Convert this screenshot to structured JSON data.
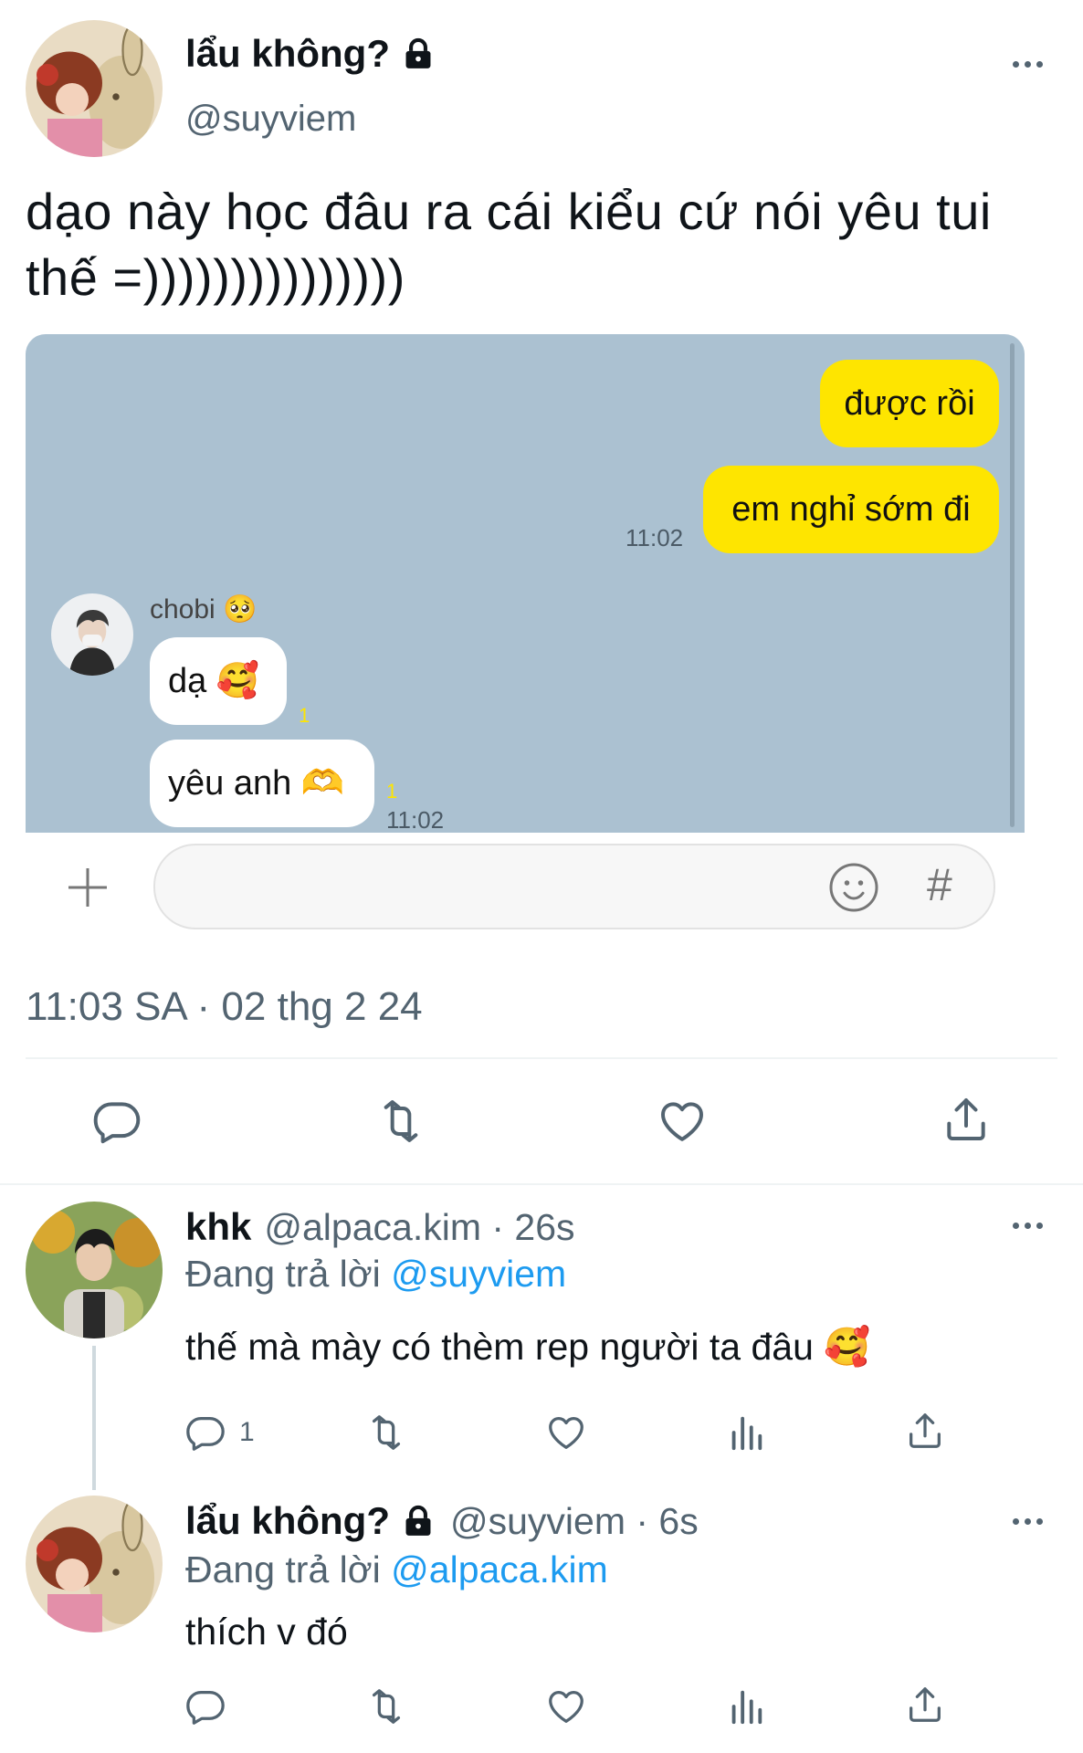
{
  "main_tweet": {
    "display_name": "lẩu không?",
    "handle": "@suyviem",
    "text_line1": "dạo này học đâu ra cái kiểu cứ nói yêu tui",
    "text_line2": "thế =)))))))))))))))",
    "timestamp": "11:03 SA · 02 thg 2 24"
  },
  "chat": {
    "out_message_1": "được rồi",
    "out_message_2": "em nghỉ sớm đi",
    "out_time": "11:02",
    "sender_name": "chobi 🥺",
    "in_message_1": "dạ 🥰",
    "in_message_2": "yêu anh 🫶",
    "in_unread_1": "1",
    "in_unread_2": "1",
    "in_time": "11:02",
    "hash_label": "#"
  },
  "reply1": {
    "display_name": "khk",
    "handle_time": "@alpaca.kim · 26s",
    "replying_prefix": "Đang trả lời",
    "replying_to": "@suyviem",
    "text": "thế mà mày có thèm rep người ta đâu 🥰",
    "reply_count": "1"
  },
  "reply2": {
    "display_name": "lẩu không?",
    "handle_time": "@suyviem · 6s",
    "replying_prefix": "Đang trả lời",
    "replying_to": "@alpaca.kim",
    "text": "thích v đó"
  },
  "colors": {
    "link_blue": "#1d9bf0",
    "muted": "#536471",
    "chat_background": "#abc1d1",
    "chat_yellow": "#fee500"
  },
  "icons": [
    "lock-icon",
    "more-icon",
    "reply-icon",
    "retweet-icon",
    "like-icon",
    "share-icon",
    "views-icon",
    "plus-icon",
    "emoji-icon"
  ]
}
